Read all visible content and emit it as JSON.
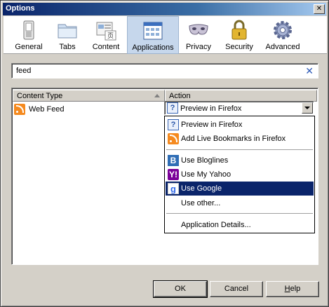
{
  "window": {
    "title": "Options",
    "close_glyph": "✕"
  },
  "toolbar": {
    "items": [
      {
        "label": "General",
        "icon": "general-switch-icon"
      },
      {
        "label": "Tabs",
        "icon": "tabs-folder-icon"
      },
      {
        "label": "Content",
        "icon": "content-page-icon"
      },
      {
        "label": "Applications",
        "icon": "applications-window-icon",
        "selected": true
      },
      {
        "label": "Privacy",
        "icon": "privacy-mask-icon"
      },
      {
        "label": "Security",
        "icon": "security-lock-icon"
      },
      {
        "label": "Advanced",
        "icon": "advanced-gear-icon"
      }
    ]
  },
  "search": {
    "value": "feed",
    "clear_glyph": "✕"
  },
  "table": {
    "columns": [
      "Content Type",
      "Action"
    ],
    "rows": [
      {
        "content_type": "Web Feed",
        "action": "Preview in Firefox"
      }
    ]
  },
  "action_menu": {
    "items": [
      {
        "label": "Preview in Firefox",
        "icon": "preview-icon"
      },
      {
        "label": "Add Live Bookmarks in Firefox",
        "icon": "feed-icon"
      },
      {
        "label": "Use Bloglines",
        "icon": "bloglines-icon"
      },
      {
        "label": "Use My Yahoo",
        "icon": "yahoo-icon"
      },
      {
        "label": "Use Google",
        "icon": "google-icon",
        "highlighted": true
      },
      {
        "label": "Use other...",
        "icon": ""
      },
      {
        "label": "Application Details...",
        "icon": ""
      }
    ]
  },
  "buttons": {
    "ok": "OK",
    "cancel": "Cancel",
    "help": "Help"
  },
  "colors": {
    "selection": "#0a246a",
    "title_bar": "#0a246a",
    "toolbar_selected": "#c6d7ec",
    "feed_orange": "#f58a1f"
  }
}
